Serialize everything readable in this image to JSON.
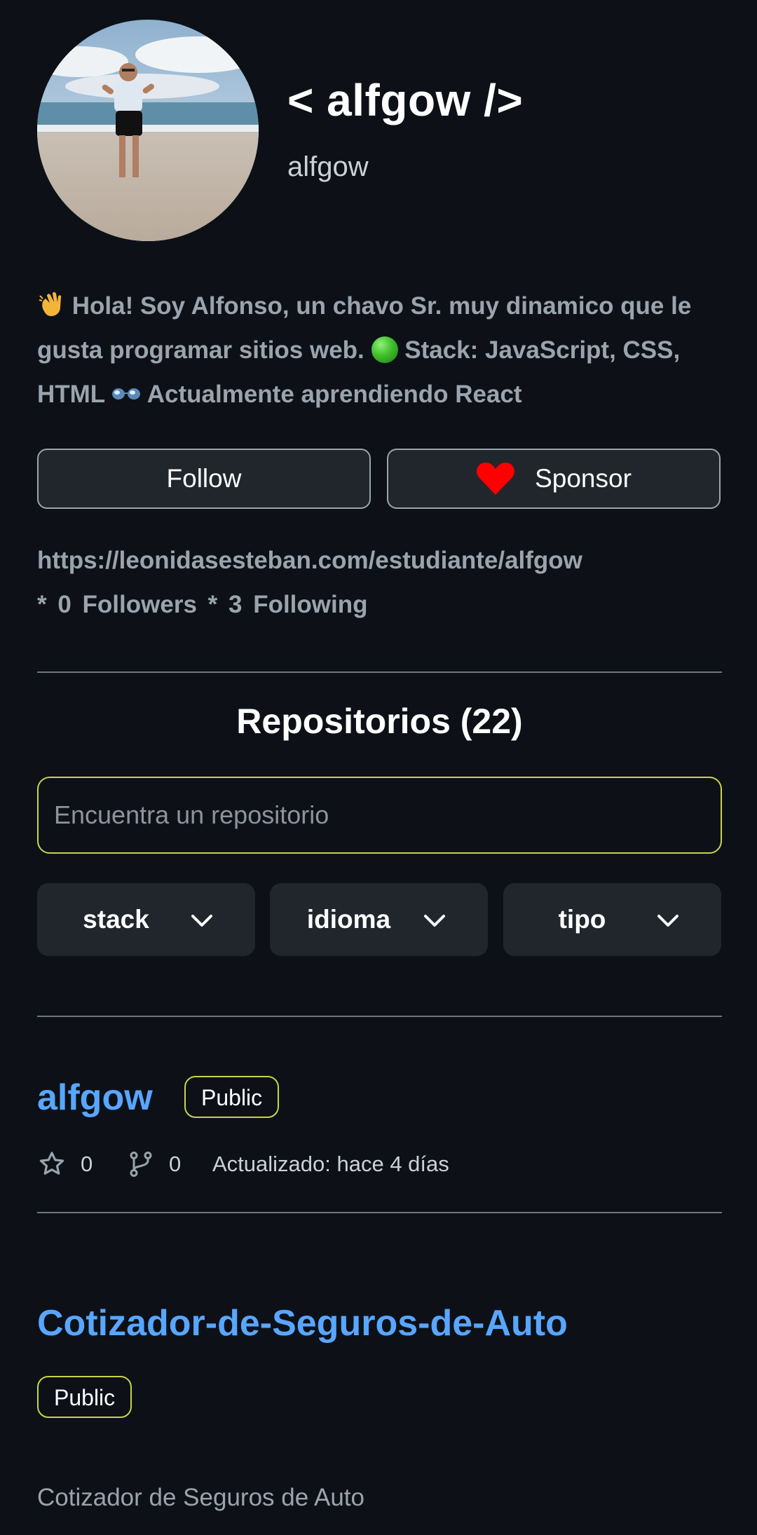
{
  "profile": {
    "display_name": "< alfgow />",
    "username": "alfgow",
    "bio_line1": "Hola! Soy Alfonso, un chavo Sr. muy dinamico que le",
    "bio_line2a": "gusta programar sitios web.",
    "bio_line2b": "Stack: JavaScript, CSS,",
    "bio_line3a": "HTML",
    "bio_line3b": "Actualmente aprendiendo React",
    "website": "https://leonidasesteban.com/estudiante/alfgow",
    "followers_count": "* 0",
    "followers_label": "Followers",
    "following_count": "* 3",
    "following_label": "Following"
  },
  "actions": {
    "follow_label": "Follow",
    "sponsor_label": "Sponsor"
  },
  "repos": {
    "title": "Repositorios (22)",
    "search_placeholder": "Encuentra un repositorio",
    "filters": [
      "stack",
      "idioma",
      "tipo"
    ],
    "items": [
      {
        "name": "alfgow",
        "visibility": "Public",
        "stars": "0",
        "forks": "0",
        "updated": "Actualizado: hace 4 días"
      },
      {
        "name": "Cotizador-de-Seguros-de-Auto",
        "visibility": "Public",
        "description": "Cotizador de Seguros de Auto"
      }
    ]
  },
  "colors": {
    "background": "#0d1117",
    "link": "#58a6ff",
    "badge_border": "#c9d44a",
    "heart": "#ff0000"
  },
  "icons": [
    "wave-icon",
    "green-circle-icon",
    "glasses-icon",
    "heart-icon",
    "chevron-down-icon",
    "star-icon",
    "fork-icon"
  ]
}
